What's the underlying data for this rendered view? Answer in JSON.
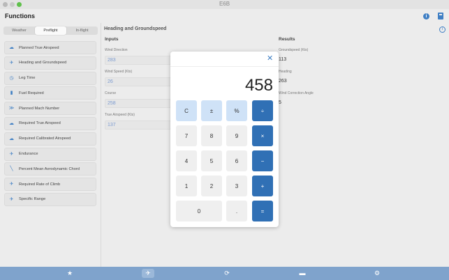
{
  "window": {
    "title": "E6B"
  },
  "header": {
    "title": "Functions",
    "info_icon": "info-icon",
    "calculator_icon": "calculator-icon"
  },
  "sidebar": {
    "segments": [
      "Weather",
      "Preflight",
      "In-flight"
    ],
    "selected_segment": "Preflight",
    "items": [
      {
        "label": "Planned True Airspeed",
        "icon": "cloud-icon"
      },
      {
        "label": "Heading and Groundspeed",
        "icon": "plane-icon"
      },
      {
        "label": "Leg Time",
        "icon": "clock-icon"
      },
      {
        "label": "Fuel Required",
        "icon": "fuel-icon"
      },
      {
        "label": "Planned Mach Number",
        "icon": "speed-icon"
      },
      {
        "label": "Required True Airspeed",
        "icon": "cloud-icon"
      },
      {
        "label": "Required Calibrated Airspeed",
        "icon": "cloud-icon"
      },
      {
        "label": "Endurance",
        "icon": "endurance-icon"
      },
      {
        "label": "Percent Mean Aerodynamic Chord",
        "icon": "wing-icon"
      },
      {
        "label": "Required Rate of Climb",
        "icon": "climb-icon"
      },
      {
        "label": "Specific Range",
        "icon": "range-icon"
      }
    ]
  },
  "main": {
    "title": "Heading and Groundspeed",
    "inputs_heading": "Inputs",
    "results_heading": "Results",
    "inputs": [
      {
        "label": "Wind Direction",
        "value": "283"
      },
      {
        "label": "Wind Speed (Kts)",
        "value": "26"
      },
      {
        "label": "Course",
        "value": "258"
      },
      {
        "label": "True Airspeed (Kts)",
        "value": "137"
      }
    ],
    "results": [
      {
        "label": "Groundspeed (Kts)",
        "value": "113"
      },
      {
        "label": "Heading",
        "value": "263"
      },
      {
        "label": "Wind Correction Angle",
        "value": "5"
      }
    ]
  },
  "calculator": {
    "display": "458",
    "close_glyph": "✕",
    "keys": {
      "clear": "C",
      "sign": "±",
      "percent": "%",
      "divide": "÷",
      "seven": "7",
      "eight": "8",
      "nine": "9",
      "multiply": "×",
      "four": "4",
      "five": "5",
      "six": "6",
      "minus": "−",
      "one": "1",
      "two": "2",
      "three": "3",
      "plus": "+",
      "zero": "0",
      "decimal": ".",
      "equals": "="
    }
  },
  "tabbar": {
    "tabs": [
      "star-icon",
      "plane-icon",
      "refresh-icon",
      "bag-icon",
      "gear-icon"
    ],
    "selected": "plane-icon"
  },
  "colors": {
    "accent": "#3070b5",
    "tabbar": "#7fa3cc",
    "light_key": "#cfe2f7"
  }
}
